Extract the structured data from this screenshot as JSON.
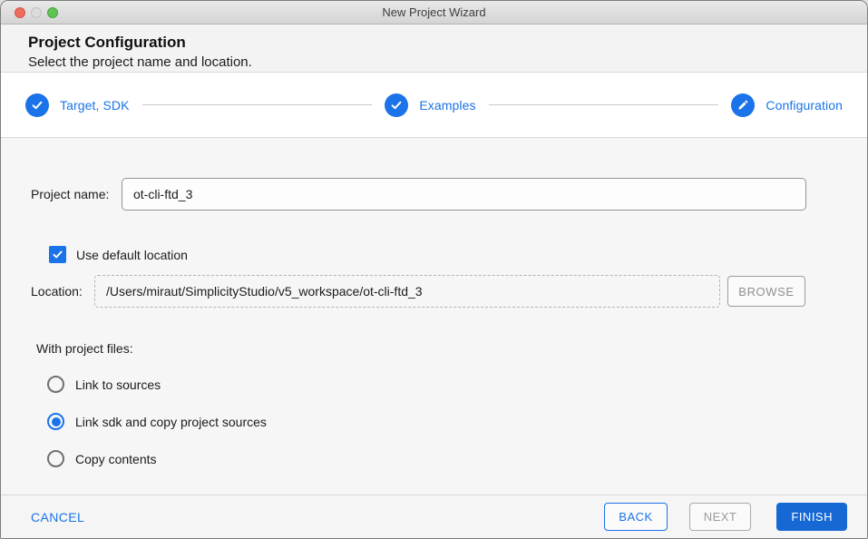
{
  "window": {
    "title": "New Project Wizard"
  },
  "header": {
    "title": "Project Configuration",
    "subtitle": "Select the project name and location."
  },
  "stepper": {
    "steps": [
      {
        "label": "Target, SDK",
        "state": "complete",
        "icon": "check-icon"
      },
      {
        "label": "Examples",
        "state": "complete",
        "icon": "check-icon"
      },
      {
        "label": "Configuration",
        "state": "current",
        "icon": "pencil-icon"
      }
    ]
  },
  "form": {
    "project_name": {
      "label": "Project name:",
      "value": "ot-cli-ftd_3"
    },
    "use_default_location": {
      "label": "Use default location",
      "checked": true
    },
    "location": {
      "label": "Location:",
      "value": "/Users/miraut/SimplicityStudio/v5_workspace/ot-cli-ftd_3",
      "browse_label": "BROWSE",
      "browse_enabled": false
    },
    "with_project_files": {
      "label": "With project files:",
      "options": [
        {
          "label": "Link to sources",
          "selected": false
        },
        {
          "label": "Link sdk and copy project sources",
          "selected": true
        },
        {
          "label": "Copy contents",
          "selected": false
        }
      ]
    }
  },
  "footer": {
    "cancel_label": "CANCEL",
    "back_label": "BACK",
    "next_label": "NEXT",
    "finish_label": "FINISH",
    "next_enabled": false
  },
  "colors": {
    "accent": "#1a73e8",
    "finish_bg": "#1668d5",
    "check_white": "#ffffff"
  }
}
